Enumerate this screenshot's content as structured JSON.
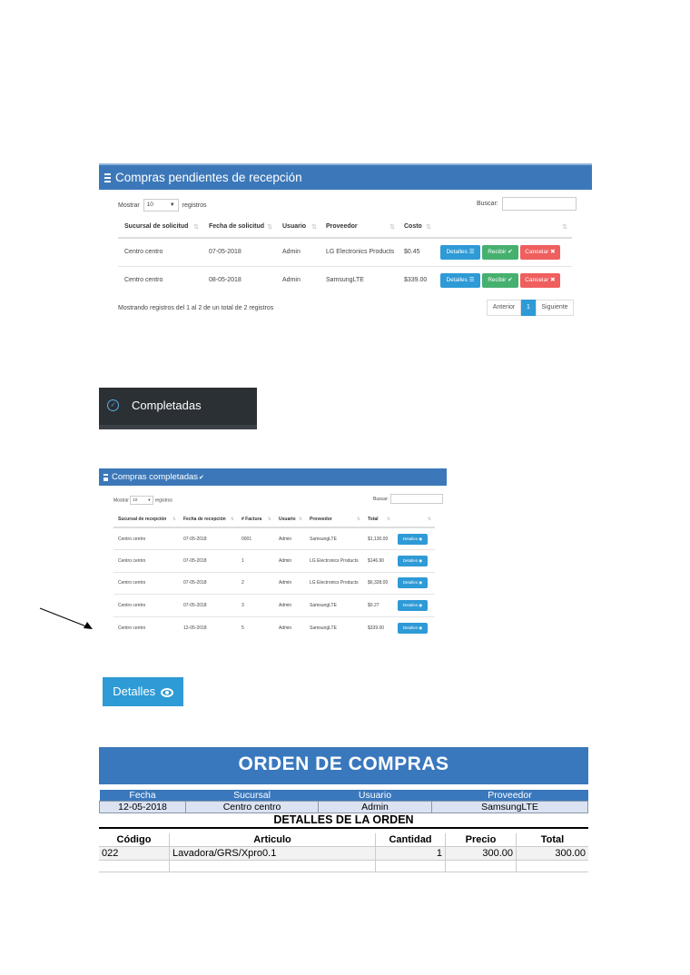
{
  "pending": {
    "title": "Compras pendientes de recepción",
    "show_label": "Mostrar",
    "page_size": "10",
    "records_label": "registros",
    "search_label": "Buscar:",
    "columns": [
      "Sucursal de solicitud",
      "Fecha de solicitud",
      "Usuario",
      "Proveedor",
      "Costo"
    ],
    "rows": [
      {
        "sucursal": "Centro centro",
        "fecha": "07-05-2018",
        "usuario": "Admin",
        "proveedor": "LG Electronics Products",
        "costo": "$0.45"
      },
      {
        "sucursal": "Centro centro",
        "fecha": "08-05-2018",
        "usuario": "Admin",
        "proveedor": "SamsungLTE",
        "costo": "$339.00"
      }
    ],
    "btn_details": "Detalles",
    "btn_receive": "Recibir",
    "btn_cancel": "Cancelar",
    "info": "Mostrando registros del 1 al 2 de un total de 2 registros",
    "prev": "Anterior",
    "page": "1",
    "next": "Siguiente"
  },
  "completed_tab": {
    "label": "Completadas"
  },
  "completed": {
    "title": "Compras completadas",
    "show_label": "Mostrar",
    "page_size": "10",
    "records_label": "registros",
    "search_label": "Buscar:",
    "columns": [
      "Sucursal de recepción",
      "Fecha de recepción",
      "# Factura",
      "Usuario",
      "Proveedor",
      "Total"
    ],
    "rows": [
      {
        "sucursal": "Centro centro",
        "fecha": "07-05-2018",
        "factura": "0001",
        "usuario": "Admin",
        "proveedor": "SamsungLTE",
        "total": "$1,130.00"
      },
      {
        "sucursal": "Centro centro",
        "fecha": "07-05-2018",
        "factura": "1",
        "usuario": "Admin",
        "proveedor": "LG Electronics Products",
        "total": "$146.90"
      },
      {
        "sucursal": "Centro centro",
        "fecha": "07-05-2018",
        "factura": "2",
        "usuario": "Admin",
        "proveedor": "LG Electronics Products",
        "total": "$6,328.00"
      },
      {
        "sucursal": "Centro centro",
        "fecha": "07-05-2018",
        "factura": "3",
        "usuario": "Admin",
        "proveedor": "SamsungLTE",
        "total": "$0.27"
      },
      {
        "sucursal": "Centro centro",
        "fecha": "12-05-2018",
        "factura": "5",
        "usuario": "Admin",
        "proveedor": "SamsungLTE",
        "total": "$339.00"
      }
    ],
    "btn_details": "Detalles"
  },
  "details_button": {
    "label": "Detalles"
  },
  "order": {
    "title": "ORDEN DE COMPRAS",
    "header_cols": [
      "Fecha",
      "Sucursal",
      "Usuario",
      "Proveedor"
    ],
    "header_vals": [
      "12-05-2018",
      "Centro centro",
      "Admin",
      "SamsungLTE"
    ],
    "details_title": "DETALLES DE LA ORDEN",
    "item_cols": [
      "Código",
      "Articulo",
      "Cantidad",
      "Precio",
      "Total"
    ],
    "items": [
      {
        "codigo": "022",
        "articulo": "Lavadora/GRS/Xpro0.1",
        "cantidad": "1",
        "precio": "300.00",
        "total": "300.00"
      }
    ]
  },
  "colors": {
    "panel_blue": "#3c78b9",
    "btn_blue": "#2e9ad6",
    "btn_green": "#46b06f",
    "btn_red": "#ef5f5e",
    "tab_dark": "#2b3035",
    "order_blue": "#3a78bd"
  },
  "icons": [
    "list-icon",
    "check-icon",
    "times-icon",
    "eye-icon",
    "check-circle-icon",
    "caret-down-icon"
  ]
}
